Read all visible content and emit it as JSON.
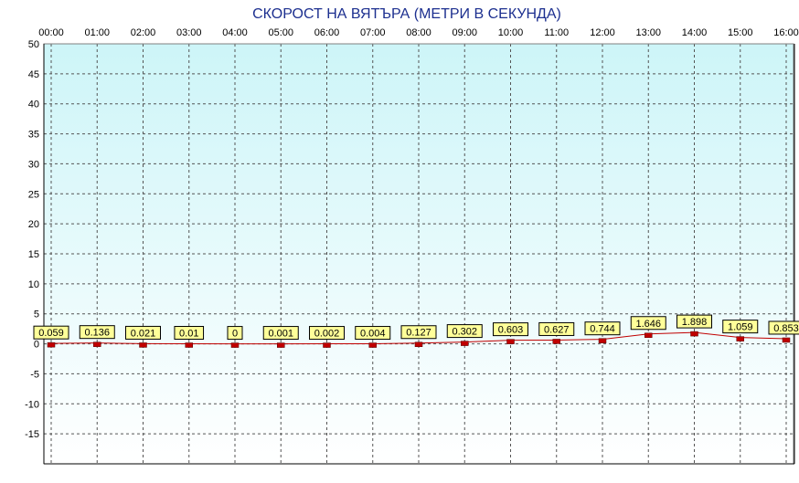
{
  "chart_data": {
    "type": "line",
    "title": "СКОРОСТ НА ВЯТЪРА (МЕТРИ В СЕКУНДА)",
    "x": [
      "00:00",
      "01:00",
      "02:00",
      "03:00",
      "04:00",
      "05:00",
      "06:00",
      "07:00",
      "08:00",
      "09:00",
      "10:00",
      "11:00",
      "12:00",
      "13:00",
      "14:00",
      "15:00",
      "16:00"
    ],
    "series": [
      {
        "values": [
          0.059,
          0.136,
          0.021,
          0.01,
          0,
          0.001,
          0.002,
          0.004,
          0.127,
          0.302,
          0.603,
          0.627,
          0.744,
          1.646,
          1.898,
          1.059,
          0.853
        ],
        "labels": [
          "0.059",
          "0.136",
          "0.021",
          "0.01",
          "0",
          "0.001",
          "0.002",
          "0.004",
          "0.127",
          "0.302",
          "0.603",
          "0.627",
          "0.744",
          "1.646",
          "1.898",
          "1.059",
          "0.853"
        ]
      }
    ],
    "yticks": [
      50,
      45,
      40,
      35,
      30,
      25,
      20,
      15,
      10,
      5,
      0,
      -5,
      -10,
      -15
    ],
    "ylim": [
      -20,
      50
    ],
    "grid": true,
    "colors": {
      "title": "#1c2f8f",
      "line": "#c00000",
      "marker": "#c00000",
      "label_bg": "#ffff99",
      "plot_top": "#cdf5f8",
      "plot_bottom": "#ffffff",
      "grid": "#555555"
    }
  }
}
